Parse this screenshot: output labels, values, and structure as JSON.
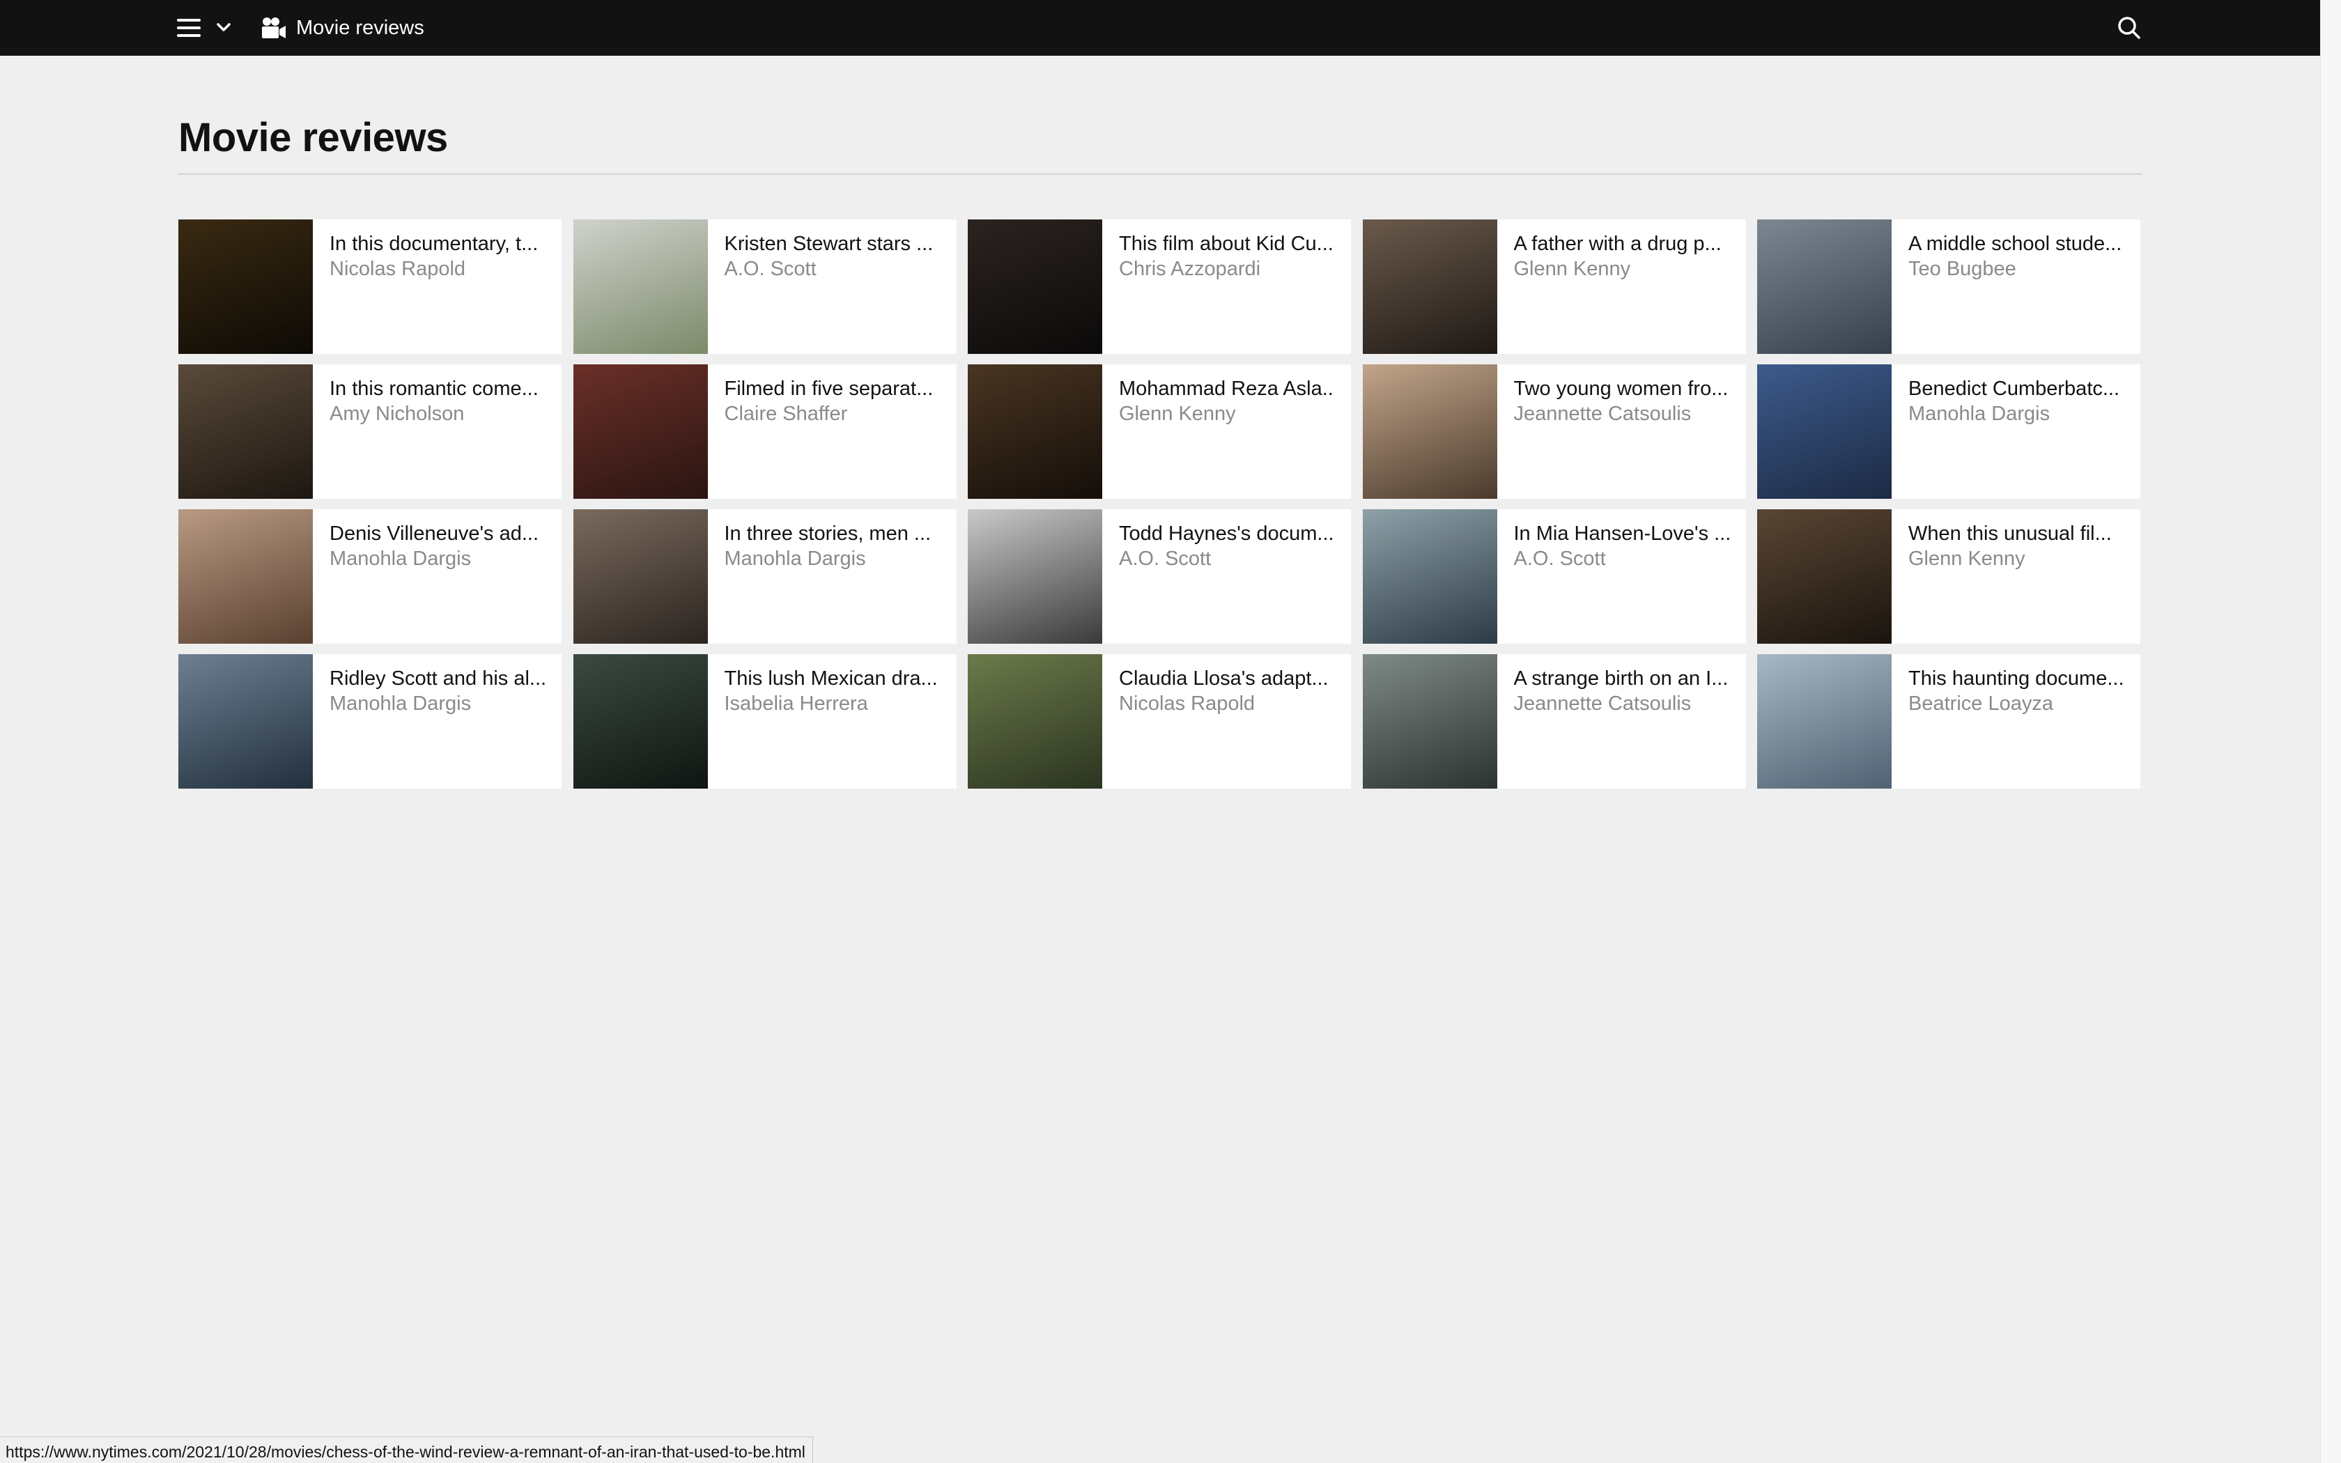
{
  "topbar": {
    "title": "Movie reviews",
    "icons": [
      "hamburger-menu-icon",
      "chevron-down-icon",
      "movie-camera-icon",
      "search-icon"
    ]
  },
  "page": {
    "heading": "Movie reviews"
  },
  "cards": [
    {
      "title": "In this documentary, t...",
      "author": "Nicolas Rapold",
      "thumb_colors": [
        "#3a2a12",
        "#0d0a05"
      ]
    },
    {
      "title": "Kristen Stewart stars ...",
      "author": "A.O. Scott",
      "thumb_colors": [
        "#cfd2cc",
        "#7c8a6a"
      ]
    },
    {
      "title": "This film about Kid Cu...",
      "author": "Chris Azzopardi",
      "thumb_colors": [
        "#2b2320",
        "#0b0a09"
      ]
    },
    {
      "title": "A father with a drug p...",
      "author": "Glenn Kenny",
      "thumb_colors": [
        "#6b5a4c",
        "#1e1914"
      ]
    },
    {
      "title": "A middle school stude...",
      "author": "Teo Bugbee",
      "thumb_colors": [
        "#7b8791",
        "#36404a"
      ]
    },
    {
      "title": "In this romantic come...",
      "author": "Amy Nicholson",
      "thumb_colors": [
        "#5a4a3a",
        "#1d1711"
      ]
    },
    {
      "title": "Filmed in five separat...",
      "author": "Claire Shaffer",
      "thumb_colors": [
        "#6b2f28",
        "#2a1512"
      ]
    },
    {
      "title": "Mohammad Reza Asla...",
      "author": "Glenn Kenny",
      "thumb_colors": [
        "#4a3522",
        "#140e09"
      ]
    },
    {
      "title": "Two young women fro...",
      "author": "Jeannette Catsoulis",
      "thumb_colors": [
        "#c2a58a",
        "#4a3a2c"
      ]
    },
    {
      "title": "Benedict Cumberbatc...",
      "author": "Manohla Dargis",
      "thumb_colors": [
        "#3d5b8c",
        "#1c2a44"
      ]
    },
    {
      "title": "Denis Villeneuve's ad...",
      "author": "Manohla Dargis",
      "thumb_colors": [
        "#b99a82",
        "#5a4030"
      ]
    },
    {
      "title": "In three stories, men ...",
      "author": "Manohla Dargis",
      "thumb_colors": [
        "#7a6a5e",
        "#2b241f"
      ]
    },
    {
      "title": "Todd Haynes's docum...",
      "author": "A.O. Scott",
      "thumb_colors": [
        "#c9c9c9",
        "#3a3a3a"
      ]
    },
    {
      "title": "In Mia Hansen-Love's ...",
      "author": "A.O. Scott",
      "thumb_colors": [
        "#8fa0a8",
        "#2c3b45"
      ]
    },
    {
      "title": "When this unusual fil...",
      "author": "Glenn Kenny",
      "thumb_colors": [
        "#5a4634",
        "#1a140e"
      ]
    },
    {
      "title": "Ridley Scott and his al...",
      "author": "Manohla Dargis",
      "thumb_colors": [
        "#6d7f92",
        "#22303d"
      ]
    },
    {
      "title": "This lush Mexican dra...",
      "author": "Isabelia Herrera",
      "thumb_colors": [
        "#3b4a40",
        "#0f1512"
      ]
    },
    {
      "title": "Claudia Llosa's adapt...",
      "author": "Nicolas Rapold",
      "thumb_colors": [
        "#6c7a4a",
        "#2b3420"
      ]
    },
    {
      "title": "A strange birth on an I...",
      "author": "Jeannette Catsoulis",
      "thumb_colors": [
        "#7f8a86",
        "#2c3330"
      ]
    },
    {
      "title": "This haunting docume...",
      "author": "Beatrice Loayza",
      "thumb_colors": [
        "#a6b8c6",
        "#506272"
      ]
    }
  ],
  "status_bar": {
    "url": "https://www.nytimes.com/2021/10/28/movies/chess-of-the-wind-review-a-remnant-of-an-iran-that-used-to-be.html"
  }
}
